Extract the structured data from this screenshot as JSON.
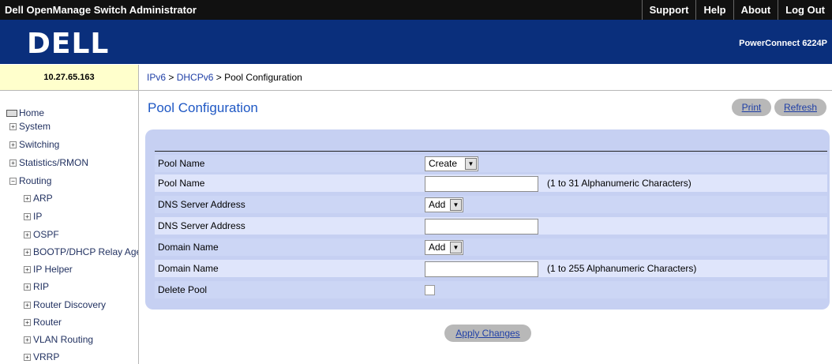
{
  "header": {
    "app_title": "Dell OpenManage Switch Administrator",
    "nav": [
      "Support",
      "Help",
      "About",
      "Log Out"
    ],
    "logo": "DELL",
    "model": "PowerConnect 6224P"
  },
  "device_ip": "10.27.65.163",
  "breadcrumb": {
    "link1": "IPv6",
    "sep1": " > ",
    "link2": "DHCPv6",
    "sep2": " > ",
    "current": "Pool Configuration"
  },
  "tree": {
    "home": "Home",
    "items": [
      "System",
      "Switching",
      "Statistics/RMON",
      "Routing"
    ],
    "routing_children": [
      "ARP",
      "IP",
      "OSPF",
      "BOOTP/DHCP Relay Agent",
      "IP Helper",
      "RIP",
      "Router Discovery",
      "Router",
      "VLAN Routing",
      "VRRP"
    ]
  },
  "page": {
    "title": "Pool Configuration",
    "print_label": "Print",
    "refresh_label": "Refresh",
    "apply_label": "Apply Changes"
  },
  "form": {
    "pool_name_select_label": "Pool Name",
    "pool_name_select_value": "Create",
    "pool_name_input_label": "Pool Name",
    "pool_name_input_value": "",
    "pool_name_hint": "(1 to 31 Alphanumeric Characters)",
    "dns_select_label": "DNS Server Address",
    "dns_select_value": "Add",
    "dns_input_label": "DNS Server Address",
    "dns_input_value": "",
    "domain_select_label": "Domain Name",
    "domain_select_value": "Add",
    "domain_input_label": "Domain Name",
    "domain_input_value": "",
    "domain_hint": "(1 to 255 Alphanumeric Characters)",
    "delete_label": "Delete Pool",
    "delete_checked": false
  },
  "colors": {
    "topbar": "#111111",
    "banner": "#0a2f7c",
    "ipbox": "#ffffcc",
    "panel": "#c6d0f2",
    "title": "#1f58c4"
  }
}
